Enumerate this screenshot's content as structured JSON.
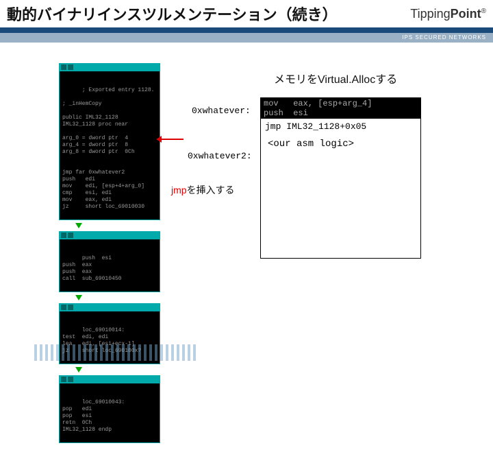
{
  "header": {
    "title": "動的バイナリインスツルメンテーション（続き）",
    "logo_light": "Tipping",
    "logo_bold": "Point",
    "logo_reg": "®",
    "subbar": "IPS SECURED NETWORKS"
  },
  "labels": {
    "valloc": "メモリをVirtual.Allocする",
    "addr1": "0xwhatever:",
    "addr2": "0xwhatever2:",
    "jmp_insert_pre": "jmp",
    "jmp_insert_post": "を挿入する"
  },
  "memory": {
    "line1": "mov   eax, [esp+arg_4]",
    "line2": "push  esi",
    "jmp": "jmp IML32_1128+0x05",
    "ourlogic": "<our asm logic>"
  },
  "ida": {
    "block1": "; Exported entry 1128.\n\n; _inHemCopy\n\npublic IML32_1128\nIML32_1128 proc near\n\narg_0 = dword ptr  4\narg_4 = dword ptr  8\narg_8 = dword ptr  0Ch\n\n\njmp far 0xwhatever2\npush   edi\nmov    edi, [esp+4+arg_0]\ncmp    esi, edi\nmov    eax, edi\njz     short loc_69010030",
    "block2": "push  esi\npush  eax\npush  eax\ncall  sub_69010450",
    "block3": "loc_69010014:\ntest  edi, edi\nlea   edi, [esi+ecx-1]\njz    short loc_690100x?",
    "block4": "loc_69010043:\npop   edi\npop   esi\nretn  0Ch\nIML32_1128 endp"
  }
}
